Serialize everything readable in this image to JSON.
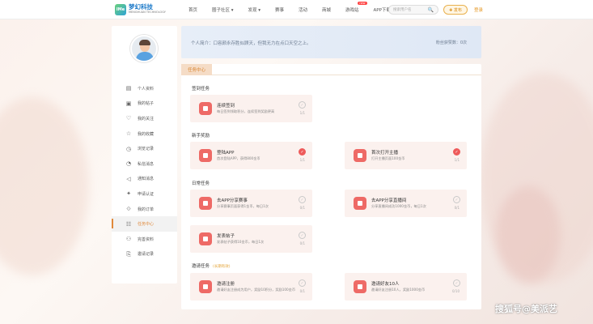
{
  "header": {
    "logo_mark": "IMe",
    "logo_cn": "梦幻科技",
    "logo_en": "MENGHUAN TECHNOLOGY",
    "nav": [
      {
        "label": "首页"
      },
      {
        "label": "圈子社区 ▾"
      },
      {
        "label": "发现 ▾"
      },
      {
        "label": "赛事"
      },
      {
        "label": "活动"
      },
      {
        "label": "商城"
      },
      {
        "label": "游戏站",
        "badge": "new"
      },
      {
        "label": "APP下载"
      }
    ],
    "search_placeholder": "搜索用户名",
    "search_icon": "🔍",
    "publish_label": "✚ 发布",
    "login_label": "登录"
  },
  "sidebar": {
    "items": [
      {
        "icon": "▤",
        "icon_name": "profile-icon",
        "label": "个人资料"
      },
      {
        "icon": "▣",
        "icon_name": "post-icon",
        "label": "我的帖子"
      },
      {
        "icon": "♡",
        "icon_name": "follow-icon",
        "label": "我的关注"
      },
      {
        "icon": "☆",
        "icon_name": "favorite-icon",
        "label": "我的收藏"
      },
      {
        "icon": "◷",
        "icon_name": "history-icon",
        "label": "浏览记录"
      },
      {
        "icon": "◔",
        "icon_name": "message-icon",
        "label": "私信消息"
      },
      {
        "icon": "◁",
        "icon_name": "notice-icon",
        "label": "通知消息"
      },
      {
        "icon": "✦",
        "icon_name": "apply-icon",
        "label": "申请认证"
      },
      {
        "icon": "⟐",
        "icon_name": "order-icon",
        "label": "我的订单"
      },
      {
        "icon": "☷",
        "icon_name": "task-icon",
        "label": "任务中心"
      },
      {
        "icon": "⚇",
        "icon_name": "benefit-icon",
        "label": "完善资料"
      },
      {
        "icon": "⎘",
        "icon_name": "invite-icon",
        "label": "邀请记录"
      }
    ],
    "active_index": 9
  },
  "intro": {
    "text": "个人简介：口容颜永存胜似顾天，但我无力在点口天空之上。",
    "fans": "粉丝获赞数：0次"
  },
  "main": {
    "tab_label": "任务中心",
    "sections": [
      {
        "title": "签到任务",
        "sub": ""
      },
      {
        "title": "新手奖励",
        "sub": ""
      },
      {
        "title": "日常任务",
        "sub": ""
      },
      {
        "title": "邀请任务",
        "sub": "(长期有效)"
      }
    ],
    "tasks": [
      {
        "name": "连续签到",
        "desc": "每日签到领取积分，连续签到奖励更高",
        "progress": "1/1",
        "done": false
      },
      {
        "name": "登陆APP",
        "desc": "首次登陆APP，获得800金币",
        "progress": "1/1",
        "done": true
      },
      {
        "name": "首次打开主播",
        "desc": "打开主播页面100金币",
        "progress": "1/1",
        "done": true
      },
      {
        "name": "去APP分享赛事",
        "desc": "分享赛事页面获得1金币，每日1次",
        "progress": "0/1",
        "done": false
      },
      {
        "name": "去APP分享直播间",
        "desc": "分享直播间成功1000金币，每日1次",
        "progress": "0/1",
        "done": false
      },
      {
        "name": "发表帖子",
        "desc": "发表帖子获得10金币，每日1次",
        "progress": "0/1",
        "done": false
      },
      {
        "name": "邀请注册",
        "desc": "邀请好友注册成为用户，奖励10积分，奖励100金币",
        "progress": "0/1",
        "done": false
      },
      {
        "name": "邀请好友10人",
        "desc": "邀请好友注册10人，奖励1000金币",
        "progress": "0/10",
        "done": false
      }
    ]
  },
  "watermark": "搜狐号@美派艺"
}
